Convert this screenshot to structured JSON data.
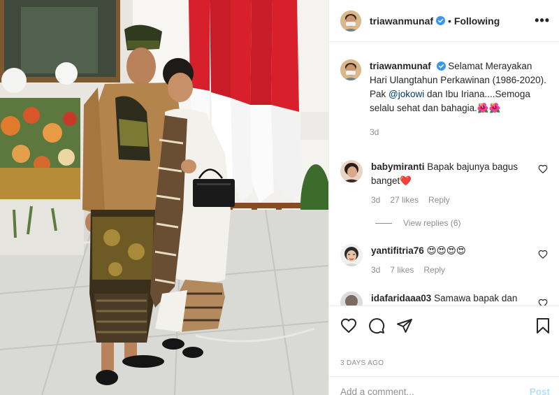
{
  "post": {
    "author": "triawanmunaf",
    "follow_label": "Following",
    "separator": "•",
    "more_label": "•••"
  },
  "caption": {
    "username": "triawanmunaf",
    "text_before": "Selamat Merayakan Hari Ulangtahun Perkawinan (1986-2020). Pak ",
    "mention": "@jokowi",
    "text_after": " dan Ibu Iriana....Semoga selalu sehat dan bahagia.🌺🌺",
    "time": "3d"
  },
  "comments": [
    {
      "username": "babymiranti",
      "text": "Bapak bajunya bagus banget❤️",
      "time": "3d",
      "likes": "27 likes",
      "reply_label": "Reply"
    },
    {
      "username": "yantifitria76",
      "text": "😍😍😍😍",
      "time": "3d",
      "likes": "7 likes",
      "reply_label": "Reply"
    },
    {
      "username": "idafaridaaa03",
      "text": "Samawa bapak dan ibu",
      "time": "",
      "likes": "",
      "reply_label": ""
    }
  ],
  "view_replies": "View replies (6)",
  "footer": {
    "date": "3 DAYS AGO",
    "add_comment_placeholder": "Add a comment...",
    "post_label": "Post"
  },
  "icons": [
    "heart-icon",
    "comment-icon",
    "share-icon",
    "save-icon",
    "verified-icon",
    "more-icon"
  ],
  "colors": {
    "verified": "#3897f0",
    "mention": "#00376b",
    "post_button": "#b2dffc",
    "muted": "#8e8e8e",
    "flag_red": "#d8202c"
  }
}
